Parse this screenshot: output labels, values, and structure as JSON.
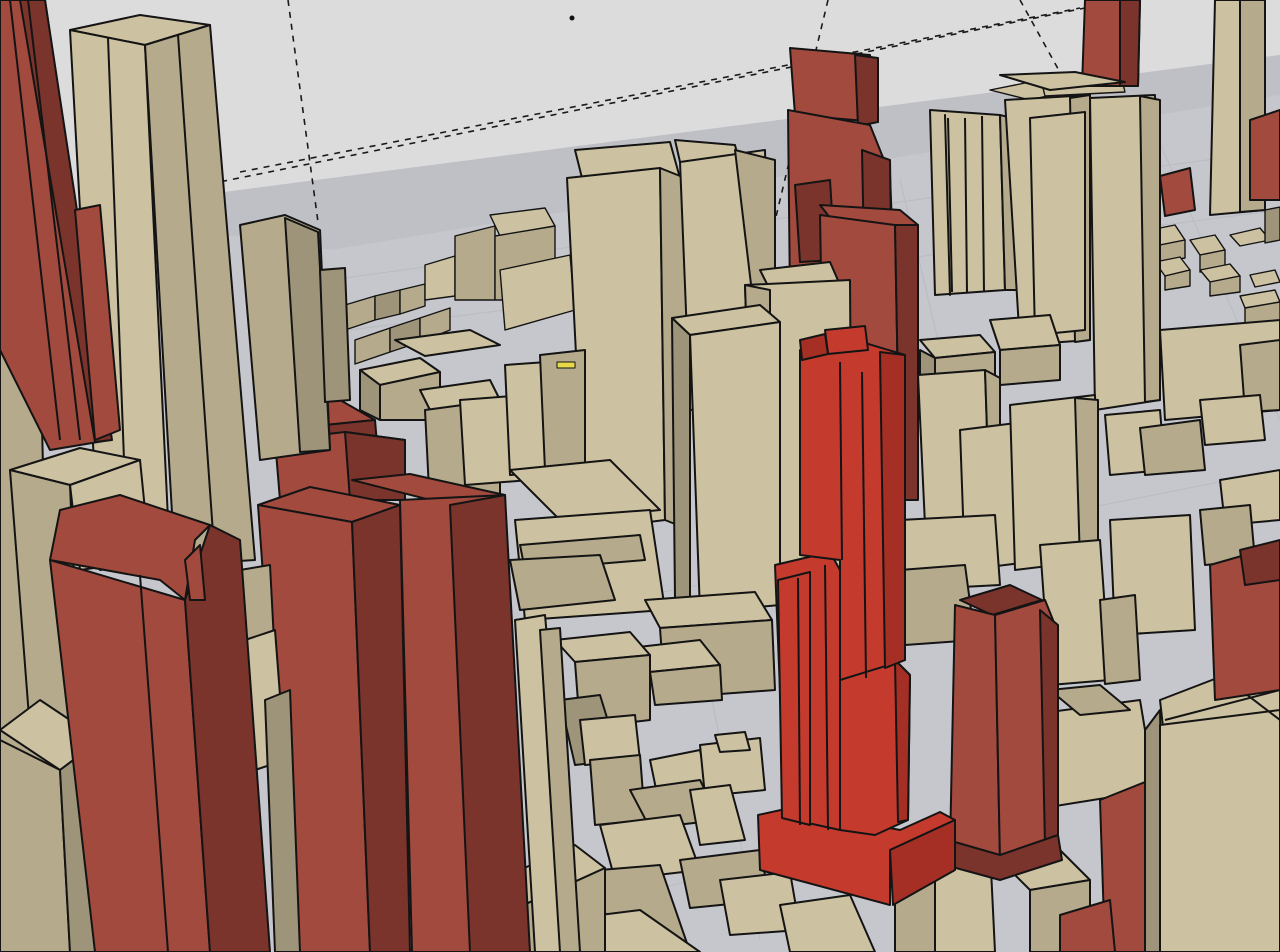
{
  "viewport": {
    "view": "3d-perspective",
    "subject": "city-massing-model",
    "selected_highlight": "selected-tower"
  },
  "colors": {
    "sky": "#dcdcdc",
    "ground": "#c6c7cc",
    "ground_far": "#bfc0c6",
    "street_line": "#b6b8c0",
    "context_light": "#ccc1a0",
    "context_mid": "#b5ab8c",
    "context_dark": "#9e9479",
    "highlight_light": "#a24a3e",
    "highlight_dark": "#7a342c",
    "selected_light": "#c43b2e",
    "selected_dark": "#a52f25",
    "outline": "#141414",
    "guide_line": "#1a1a1a"
  },
  "icons": {
    "marker": "dot-marker-icon"
  }
}
